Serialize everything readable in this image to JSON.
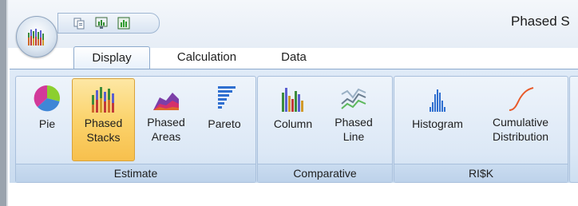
{
  "window": {
    "title": "Phased S"
  },
  "quick_access": {
    "icons": [
      "copy-icon",
      "chart-export-icon",
      "chart-excel-icon"
    ]
  },
  "tabs": [
    {
      "label": "Display",
      "active": true
    },
    {
      "label": "Calculation",
      "active": false
    },
    {
      "label": "Data",
      "active": false
    }
  ],
  "groups": {
    "estimate": {
      "label": "Estimate",
      "buttons": [
        {
          "line1": "Pie",
          "line2": "",
          "icon": "pie-chart-icon"
        },
        {
          "line1": "Phased",
          "line2": "Stacks",
          "icon": "phased-stacks-icon",
          "selected": true
        },
        {
          "line1": "Phased",
          "line2": "Areas",
          "icon": "phased-areas-icon"
        },
        {
          "line1": "Pareto",
          "line2": "",
          "icon": "pareto-icon"
        }
      ]
    },
    "comparative": {
      "label": "Comparative",
      "buttons": [
        {
          "line1": "Column",
          "line2": "",
          "icon": "column-chart-icon"
        },
        {
          "line1": "Phased",
          "line2": "Line",
          "icon": "phased-line-icon"
        }
      ]
    },
    "risk": {
      "label": "RI$K",
      "buttons": [
        {
          "line1": "Histogram",
          "line2": "",
          "icon": "histogram-icon"
        },
        {
          "line1": "Cumulative",
          "line2": "Distribution",
          "icon": "cumulative-distribution-icon"
        }
      ]
    }
  },
  "colors": {
    "ribbon_bg": "#d3e2f3",
    "selected_button": "#fbd36c",
    "group_border": "#a9c0dc"
  }
}
